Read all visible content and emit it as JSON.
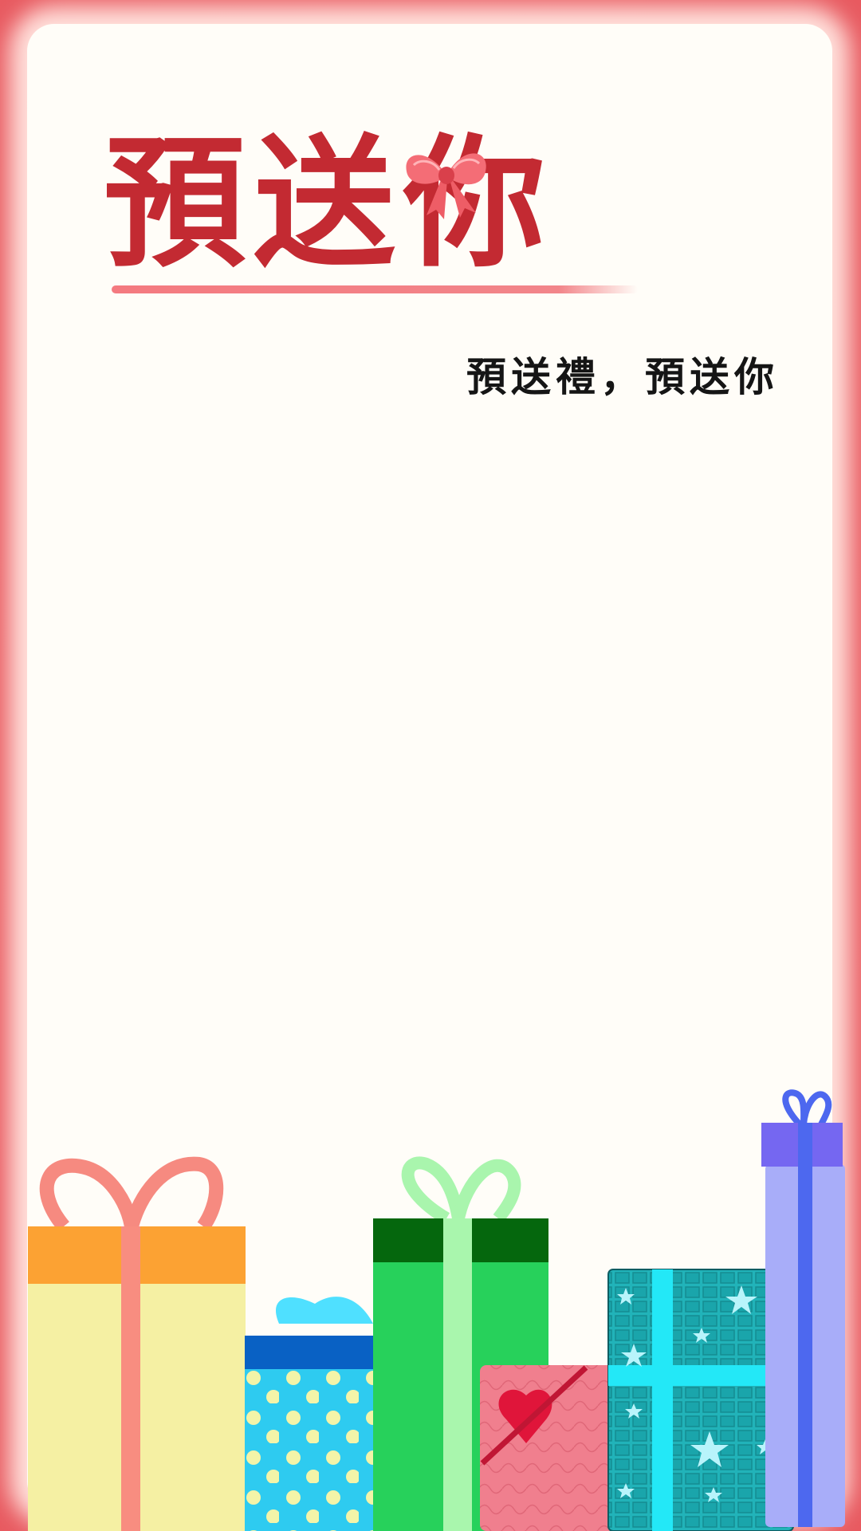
{
  "card": {
    "title": "預送你",
    "subtitle": "預送禮，預送你"
  },
  "colors": {
    "frame": "#e8565c",
    "paper": "#fffdf8",
    "title": "#c32a32",
    "underline": "#f47a80",
    "subtitle": "#151515"
  },
  "decorations": [
    "bow-icon",
    "gift-box-yellow",
    "gift-box-blue-dots",
    "gift-box-green",
    "gift-box-pink-heart",
    "gift-box-teal-stars",
    "gift-box-purple"
  ]
}
